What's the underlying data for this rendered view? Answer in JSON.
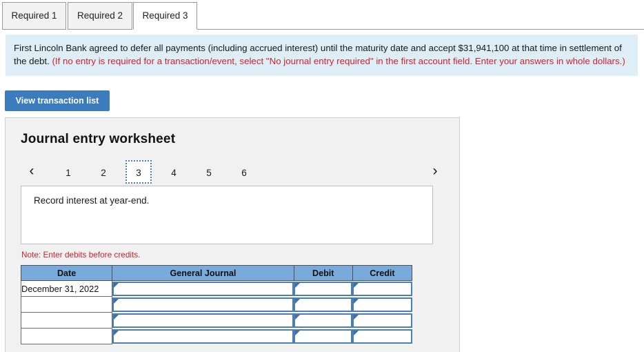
{
  "tabs": [
    {
      "label": "Required 1",
      "active": false
    },
    {
      "label": "Required 2",
      "active": false
    },
    {
      "label": "Required 3",
      "active": true
    }
  ],
  "info_banner": {
    "text_black_1": "First Lincoln Bank agreed to defer all payments (including accrued interest) until the maturity date and accept $31,941,100 at that time in settlement of the debt. ",
    "text_red": "(If no entry is required for a transaction/event, select \"No journal entry required\" in the first account field. Enter your answers in whole dollars.)",
    "background_color": "#ddeef7",
    "red_color": "#cf2129"
  },
  "toolbar": {
    "view_transaction_list_label": "View transaction list",
    "button_color": "#3a7cbe"
  },
  "worksheet": {
    "title": "Journal entry worksheet",
    "pager": {
      "prev_icon": "chevron-left-icon",
      "next_icon": "chevron-right-icon",
      "prev_glyph": "‹",
      "next_glyph": "›",
      "pages": [
        "1",
        "2",
        "3",
        "4",
        "5",
        "6"
      ],
      "current_page": "3"
    },
    "description": "Record interest at year-end.",
    "note": "Note: Enter debits before credits.",
    "note_color": "#cf2129",
    "table": {
      "header_color": "#78abdb",
      "columns": [
        "Date",
        "General Journal",
        "Debit",
        "Credit"
      ],
      "rows": [
        {
          "date": "December 31, 2022",
          "general_journal": "",
          "debit": "",
          "credit": ""
        },
        {
          "date": "",
          "general_journal": "",
          "debit": "",
          "credit": ""
        },
        {
          "date": "",
          "general_journal": "",
          "debit": "",
          "credit": ""
        },
        {
          "date": "",
          "general_journal": "",
          "debit": "",
          "credit": ""
        }
      ]
    }
  }
}
